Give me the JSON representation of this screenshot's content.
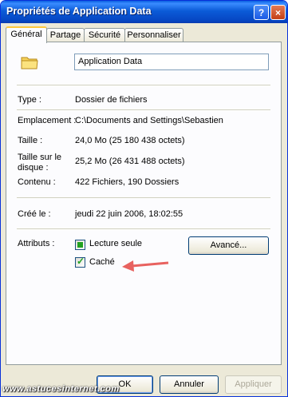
{
  "window": {
    "title": "Propriétés de Application Data",
    "help_label": "?",
    "close_label": "×"
  },
  "tabs": [
    {
      "label": "Général",
      "active": true
    },
    {
      "label": "Partage",
      "active": false
    },
    {
      "label": "Sécurité",
      "active": false
    },
    {
      "label": "Personnaliser",
      "active": false
    }
  ],
  "general": {
    "folder_icon": "folder-icon",
    "name_value": "Application Data",
    "type_label": "Type :",
    "type_value": "Dossier de fichiers",
    "location_label": "Emplacement :",
    "location_value": "C:\\Documents and Settings\\Sebastien",
    "size_label": "Taille :",
    "size_value": "24,0 Mo (25 180 438 octets)",
    "disk_size_label_1": "Taille sur le",
    "disk_size_label_2": "disque :",
    "disk_size_value": "25,2 Mo (26 431 488 octets)",
    "contents_label": "Contenu :",
    "contents_value": "422 Fichiers, 190 Dossiers",
    "created_label": "Créé le :",
    "created_value": "jeudi 22 juin 2006, 18:02:55",
    "attributes_label": "Attributs :",
    "readonly_label": "Lecture seule",
    "readonly_state": "mixed",
    "hidden_label": "Caché",
    "hidden_state": "checked",
    "advanced_button": "Avancé..."
  },
  "footer": {
    "ok": "OK",
    "cancel": "Annuler",
    "apply": "Appliquer"
  },
  "watermark": "www.astucesinternet.com",
  "colors": {
    "titlebar": "#0a5fe0",
    "arrow": "#e8625f",
    "check": "#21a121"
  }
}
